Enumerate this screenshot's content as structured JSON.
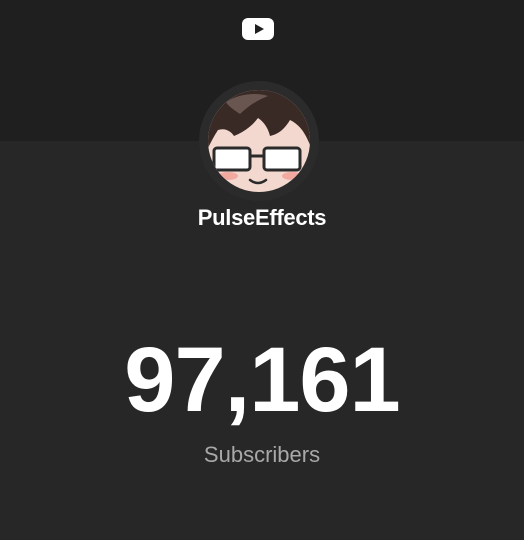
{
  "header": {
    "logo_icon": "youtube-play-icon"
  },
  "channel": {
    "name": "PulseEffects",
    "avatar_icon": "cartoon-avatar-with-glasses"
  },
  "stats": {
    "subscriber_count": "97,161",
    "subscriber_label": "Subscribers"
  },
  "colors": {
    "background": "#272727",
    "header_band": "#1f1f1f",
    "text_primary": "#ffffff",
    "text_secondary": "#a8a8a8"
  }
}
